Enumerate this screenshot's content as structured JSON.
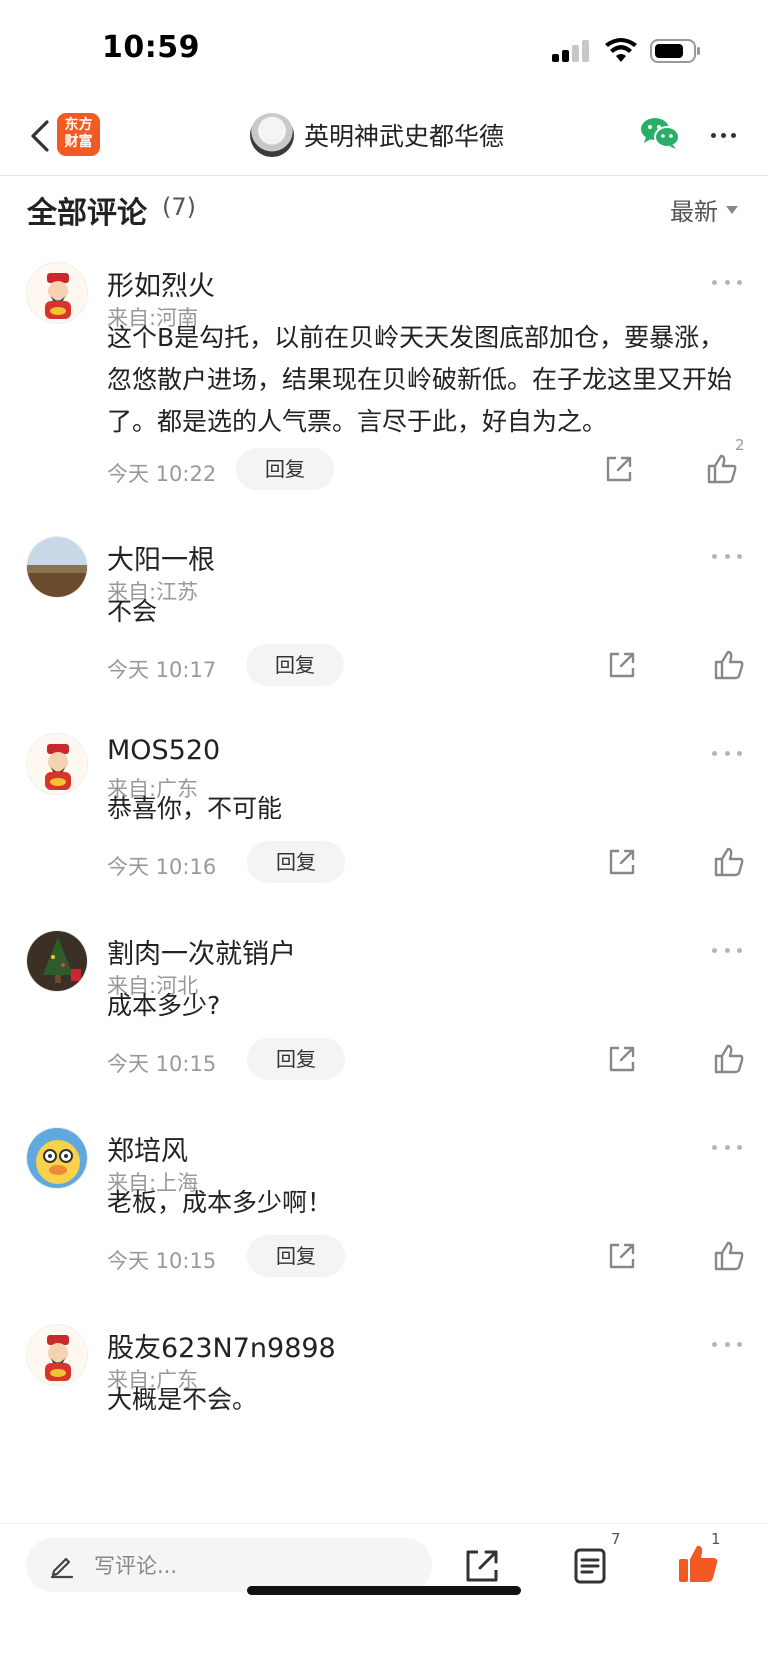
{
  "status_bar": {
    "time": "10:59"
  },
  "nav": {
    "brand_line1": "东方",
    "brand_line2": "财富",
    "title": "英明神武史都华德"
  },
  "comments_header": {
    "title": "全部评论",
    "count": "(7)",
    "sort_label": "最新"
  },
  "comments": [
    {
      "username": "形如烈火",
      "location": "来自:河南",
      "text": "这个B是勾托，以前在贝岭天天发图底部加仓，要暴涨，忽悠散户进场，结果现在贝岭破新低。在子龙这里又开始了。都是选的人气票。言尽于此，好自为之。",
      "time": "今天 10:22",
      "reply_label": "回复",
      "likes": "2",
      "avatar": "caishen-avatar"
    },
    {
      "username": "大阳一根",
      "location": "来自:江苏",
      "text": "不会",
      "time": "今天 10:17",
      "reply_label": "回复",
      "likes": "",
      "avatar": "field-photo-avatar"
    },
    {
      "username": "MOS520",
      "location": "来自:广东",
      "text": "恭喜你，不可能",
      "time": "今天 10:16",
      "reply_label": "回复",
      "likes": "",
      "avatar": "caishen-avatar"
    },
    {
      "username": "割肉一次就销户",
      "location": "来自:河北",
      "text": "成本多少?",
      "time": "今天 10:15",
      "reply_label": "回复",
      "likes": "",
      "avatar": "christmas-tree-avatar"
    },
    {
      "username": "郑培风",
      "location": "来自:上海",
      "text": "老板，成本多少啊！",
      "time": "今天 10:15",
      "reply_label": "回复",
      "likes": "",
      "avatar": "cartoon-duck-avatar"
    },
    {
      "username": "股友623N7n9898",
      "location": "来自:广东",
      "text": "大概是不会。",
      "avatar": "caishen-avatar"
    }
  ],
  "bottom_bar": {
    "input_placeholder": "写评论...",
    "comment_count": "7",
    "like_count": "1"
  },
  "colors": {
    "brand": "#f15a22",
    "wechat": "#2aae67",
    "muted": "#999999",
    "like_active": "#f15a22"
  }
}
